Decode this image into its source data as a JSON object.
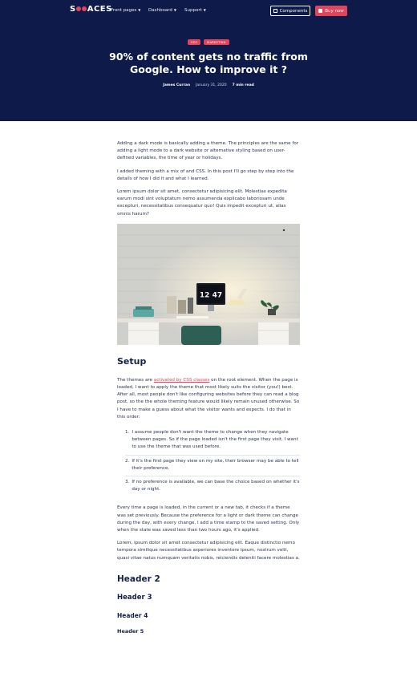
{
  "nav": {
    "logo_left": "S",
    "logo_right": "ACES",
    "items": [
      {
        "label": "Front pages"
      },
      {
        "label": "Dashboard"
      },
      {
        "label": "Support"
      }
    ],
    "components_label": "Components",
    "buy_label": "Buy now"
  },
  "hero": {
    "tags": [
      "SEO",
      "MARKETING"
    ],
    "title": "90% of content gets no traffic from Google. How to improve it ?",
    "author": "James Curran",
    "date": "January 31, 2020",
    "read_time": "7 min read"
  },
  "article": {
    "p1": "Adding a dark mode is basically adding a theme. The principles are the same for adding a light mode to a dark website or alternative styling based on user-defined variables, the time of year or holidays.",
    "p2": "I added theming with a mix of and CSS. In this post I'll go step by step into the details of how I did it and what I learned.",
    "p3": "Lorem ipsum dolor sit amet, consectetur adipisicing elit. Molestias expedita earum modi sint voluptatum nemo assumenda explicabo laboriosam unde excepturi, necessitatibus consequatur quo! Quis impedit excepturi ut, alias omnis harum?",
    "photo_clock": "12 47",
    "setup_heading": "Setup",
    "setup_p_before": "The themes are ",
    "setup_link": "activated by CSS classes",
    "setup_p_after": " on the root element. When the page is loaded, I want to apply the theme that most likely suits the visitor (you!) best. After all, most people don't like configuring websites before they can read a blog post, so the the whole theming feature would likely remain unused otherwise. So I have to make a guess about what the visitor wants and expects. I do that in this order:",
    "steps": [
      {
        "num": "1.",
        "text": "I assume people don't want the theme to change when they navigate between pages. So if the page loaded isn't the first page they visit, I want to use the theme that was used before."
      },
      {
        "num": "2.",
        "text": "If it's the first page they view on my site, their browser may be able to tell their preference."
      },
      {
        "num": "3.",
        "text": "If no preference is available, we can base the choice based on whether it's day or night."
      }
    ],
    "p4": "Every time a page is loaded, in the current or a new tab, it checks if a theme was set previously. Because the preference for a light or dark theme can change during the day, with every change, I add a time stamp to the saved setting. Only when the state was saved less than two hours ago, it's applied.",
    "p5": "Lorem, ipsum dolor sit amet consectetur adipisicing elit. Eaque distinctio nemo tempora similique necessitatibus asperiores inventore ipsum, nostrum velit, quasi vitae natus numquam veritatis nobis, reiciendis deleniti facere molestias a.",
    "h2": "Header 2",
    "h3": "Header 3",
    "h4": "Header 4",
    "h5": "Header 5"
  }
}
